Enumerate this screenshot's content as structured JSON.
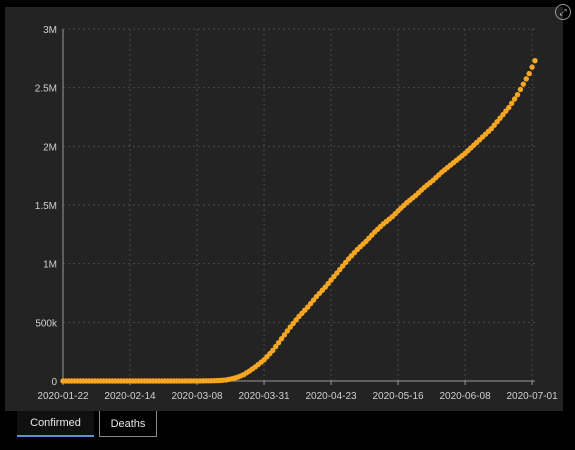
{
  "tabs": [
    {
      "label": "Confirmed",
      "active": true
    },
    {
      "label": "Deaths",
      "active": false
    }
  ],
  "colors": {
    "series": "#f5a623",
    "background": "#232323",
    "grid": "#4a4a4a",
    "tick_text": "#cfcfcf",
    "tab_active_underline": "#5b8fd8"
  },
  "icons": {
    "expand": "expand-icon"
  },
  "chart_data": {
    "type": "scatter",
    "title": "",
    "xlabel": "",
    "ylabel": "",
    "x_type": "date",
    "xlim": [
      "2020-01-22",
      "2020-07-02"
    ],
    "ylim": [
      0,
      3000000
    ],
    "x_ticks": [
      "2020-01-22",
      "2020-02-14",
      "2020-03-08",
      "2020-03-31",
      "2020-04-23",
      "2020-05-16",
      "2020-06-08",
      "2020-07-01"
    ],
    "y_ticks": [
      {
        "value": 0,
        "label": "0"
      },
      {
        "value": 500000,
        "label": "500k"
      },
      {
        "value": 1000000,
        "label": "1M"
      },
      {
        "value": 1500000,
        "label": "1.5M"
      },
      {
        "value": 2000000,
        "label": "2M"
      },
      {
        "value": 2500000,
        "label": "2.5M"
      },
      {
        "value": 3000000,
        "label": "3M"
      }
    ],
    "grid": true,
    "legend": "none",
    "series": [
      {
        "name": "",
        "points": [
          [
            "2020-01-22",
            0
          ],
          [
            "2020-02-14",
            15
          ],
          [
            "2020-03-01",
            70
          ],
          [
            "2020-03-08",
            500
          ],
          [
            "2020-03-12",
            1600
          ],
          [
            "2020-03-14",
            2700
          ],
          [
            "2020-03-16",
            4600
          ],
          [
            "2020-03-18",
            9000
          ],
          [
            "2020-03-20",
            19000
          ],
          [
            "2020-03-22",
            33000
          ],
          [
            "2020-03-24",
            54000
          ],
          [
            "2020-03-26",
            85000
          ],
          [
            "2020-03-28",
            120000
          ],
          [
            "2020-03-31",
            180000
          ],
          [
            "2020-04-03",
            260000
          ],
          [
            "2020-04-06",
            360000
          ],
          [
            "2020-04-09",
            460000
          ],
          [
            "2020-04-12",
            550000
          ],
          [
            "2020-04-15",
            630000
          ],
          [
            "2020-04-18",
            720000
          ],
          [
            "2020-04-21",
            800000
          ],
          [
            "2020-04-23",
            860000
          ],
          [
            "2020-04-26",
            950000
          ],
          [
            "2020-04-29",
            1040000
          ],
          [
            "2020-05-02",
            1120000
          ],
          [
            "2020-05-05",
            1190000
          ],
          [
            "2020-05-08",
            1270000
          ],
          [
            "2020-05-11",
            1340000
          ],
          [
            "2020-05-14",
            1400000
          ],
          [
            "2020-05-16",
            1450000
          ],
          [
            "2020-05-19",
            1520000
          ],
          [
            "2020-05-22",
            1580000
          ],
          [
            "2020-05-25",
            1650000
          ],
          [
            "2020-05-28",
            1710000
          ],
          [
            "2020-05-31",
            1780000
          ],
          [
            "2020-06-03",
            1840000
          ],
          [
            "2020-06-06",
            1900000
          ],
          [
            "2020-06-08",
            1940000
          ],
          [
            "2020-06-11",
            2010000
          ],
          [
            "2020-06-14",
            2080000
          ],
          [
            "2020-06-17",
            2150000
          ],
          [
            "2020-06-20",
            2240000
          ],
          [
            "2020-06-23",
            2330000
          ],
          [
            "2020-06-26",
            2440000
          ],
          [
            "2020-06-28",
            2530000
          ],
          [
            "2020-06-30",
            2620000
          ],
          [
            "2020-07-02",
            2730000
          ]
        ]
      }
    ]
  }
}
